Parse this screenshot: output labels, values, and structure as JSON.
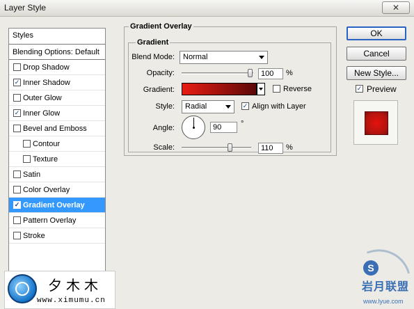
{
  "window": {
    "title": "Layer Style",
    "close_glyph": "✕"
  },
  "styles_panel": {
    "header": "Styles",
    "blending_options": "Blending Options: Default",
    "items": [
      {
        "label": "Drop Shadow",
        "checked": false
      },
      {
        "label": "Inner Shadow",
        "checked": true
      },
      {
        "label": "Outer Glow",
        "checked": false
      },
      {
        "label": "Inner Glow",
        "checked": true
      },
      {
        "label": "Bevel and Emboss",
        "checked": false
      },
      {
        "label": "Contour",
        "checked": false
      },
      {
        "label": "Texture",
        "checked": false
      },
      {
        "label": "Satin",
        "checked": false
      },
      {
        "label": "Color Overlay",
        "checked": false
      },
      {
        "label": "Gradient Overlay",
        "checked": true,
        "selected": true
      },
      {
        "label": "Pattern Overlay",
        "checked": false
      },
      {
        "label": "Stroke",
        "checked": false
      }
    ]
  },
  "gradient_overlay": {
    "group_title": "Gradient Overlay",
    "inner_title": "Gradient",
    "blend_mode_label": "Blend Mode:",
    "blend_mode_value": "Normal",
    "opacity_label": "Opacity:",
    "opacity_value": "100",
    "opacity_unit": "%",
    "opacity_level": 1.0,
    "gradient_label": "Gradient:",
    "gradient_colors": [
      "#e81d12",
      "#5c0808"
    ],
    "reverse_label": "Reverse",
    "reverse_checked": false,
    "style_label": "Style:",
    "style_value": "Radial",
    "align_label": "Align with Layer",
    "align_checked": true,
    "angle_label": "Angle:",
    "angle_value": "90",
    "angle_unit": "°",
    "scale_label": "Scale:",
    "scale_value": "110",
    "scale_unit": "%"
  },
  "buttons": {
    "ok": "OK",
    "cancel": "Cancel",
    "new_style": "New Style...",
    "preview_label": "Preview",
    "preview_checked": true
  },
  "watermarks": {
    "left_title": "夕木木",
    "left_url": "www.ximumu.cn",
    "right_text": "岩月联盟",
    "right_url": "www.lyue.com"
  },
  "check_glyph": "✓"
}
